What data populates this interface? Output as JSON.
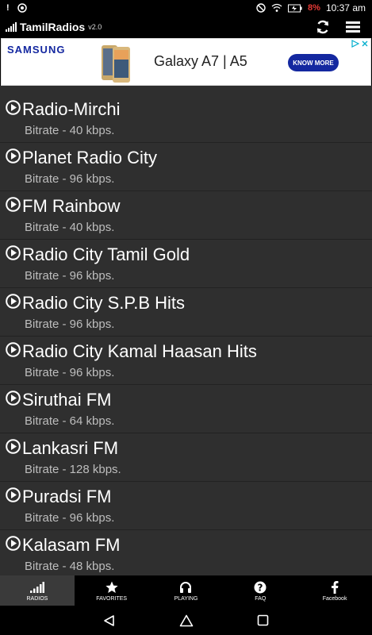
{
  "status_bar": {
    "left_icons": [
      "notification-icon",
      "app-icon"
    ],
    "battery_percent": "8%",
    "time": "10:37 am",
    "battery_color": "#e53935"
  },
  "app": {
    "title": "TamilRadios",
    "version": "v2.0",
    "actions": [
      "refresh-icon",
      "menu-icon"
    ]
  },
  "ad": {
    "brand": "SAMSUNG",
    "product": "Galaxy A7 | A5",
    "cta": "KNOW MORE",
    "brand_color": "#1428a0"
  },
  "stations": [
    {
      "name": "Radio-Mirchi",
      "bitrate": "Bitrate - 40 kbps."
    },
    {
      "name": "Planet Radio City",
      "bitrate": "Bitrate - 96 kbps."
    },
    {
      "name": "FM Rainbow",
      "bitrate": "Bitrate - 40 kbps."
    },
    {
      "name": "Radio City Tamil Gold",
      "bitrate": "Bitrate - 96 kbps."
    },
    {
      "name": "Radio City S.P.B Hits",
      "bitrate": "Bitrate - 96 kbps."
    },
    {
      "name": "Radio City Kamal Haasan Hits",
      "bitrate": "Bitrate - 96 kbps."
    },
    {
      "name": "Siruthai FM",
      "bitrate": "Bitrate - 64 kbps."
    },
    {
      "name": "Lankasri FM",
      "bitrate": "Bitrate - 128 kbps."
    },
    {
      "name": "Puradsi FM",
      "bitrate": "Bitrate - 96 kbps."
    },
    {
      "name": "Kalasam FM",
      "bitrate": "Bitrate - 48 kbps."
    }
  ],
  "tabs": [
    {
      "label": "RADIOS",
      "icon": "signal-bars-icon",
      "active": true
    },
    {
      "label": "FAVORITES",
      "icon": "star-icon",
      "active": false
    },
    {
      "label": "PLAYING",
      "icon": "headphones-icon",
      "active": false
    },
    {
      "label": "FAQ",
      "icon": "question-icon",
      "active": false
    },
    {
      "label": "Facebook",
      "icon": "facebook-icon",
      "active": false
    }
  ],
  "nav": [
    "back-icon",
    "home-icon",
    "recents-icon"
  ]
}
